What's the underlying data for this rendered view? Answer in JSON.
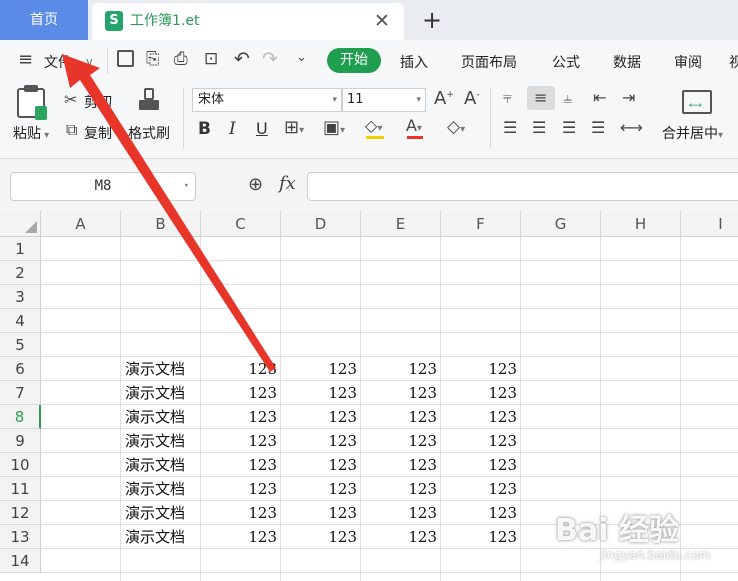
{
  "tabs": {
    "home": "首页",
    "document": "工作簿1.et",
    "new_tab": "+",
    "close": "✕"
  },
  "menu": {
    "file": "文件",
    "tabs": [
      {
        "label": "开始",
        "active": true
      },
      {
        "label": "插入"
      },
      {
        "label": "页面布局"
      },
      {
        "label": "公式"
      },
      {
        "label": "数据"
      },
      {
        "label": "审阅"
      },
      {
        "label": "视"
      }
    ]
  },
  "ribbon": {
    "paste": "粘贴",
    "cut": "剪切",
    "copy": "复制",
    "format_painter": "格式刷",
    "font_name": "宋体",
    "font_size": "11",
    "merge_center": "合并居中"
  },
  "formula_bar": {
    "cell_ref": "M8",
    "fx": "fx",
    "value": ""
  },
  "sheet": {
    "columns": [
      "A",
      "B",
      "C",
      "D",
      "E",
      "F",
      "G",
      "H",
      "I"
    ],
    "rows": [
      "1",
      "2",
      "3",
      "4",
      "5",
      "6",
      "7",
      "8",
      "9",
      "10",
      "11",
      "12",
      "13",
      "14"
    ],
    "active_row": "8",
    "data_rows": [
      {
        "row": "6",
        "label": "演示文档",
        "values": [
          "123",
          "123",
          "123",
          "123"
        ]
      },
      {
        "row": "7",
        "label": "演示文档",
        "values": [
          "123",
          "123",
          "123",
          "123"
        ]
      },
      {
        "row": "8",
        "label": "演示文档",
        "values": [
          "123",
          "123",
          "123",
          "123"
        ]
      },
      {
        "row": "9",
        "label": "演示文档",
        "values": [
          "123",
          "123",
          "123",
          "123"
        ]
      },
      {
        "row": "10",
        "label": "演示文档",
        "values": [
          "123",
          "123",
          "123",
          "123"
        ]
      },
      {
        "row": "11",
        "label": "演示文档",
        "values": [
          "123",
          "123",
          "123",
          "123"
        ]
      },
      {
        "row": "12",
        "label": "演示文档",
        "values": [
          "123",
          "123",
          "123",
          "123"
        ]
      },
      {
        "row": "13",
        "label": "演示文档",
        "values": [
          "123",
          "123",
          "123",
          "123"
        ]
      }
    ]
  },
  "watermark": {
    "text": "Bai 经验",
    "sub": "jingyan.baidu.com"
  },
  "colors": {
    "accent": "#1f9e4f",
    "home_tab": "#5b8de8",
    "arrow": "#e8352a"
  }
}
